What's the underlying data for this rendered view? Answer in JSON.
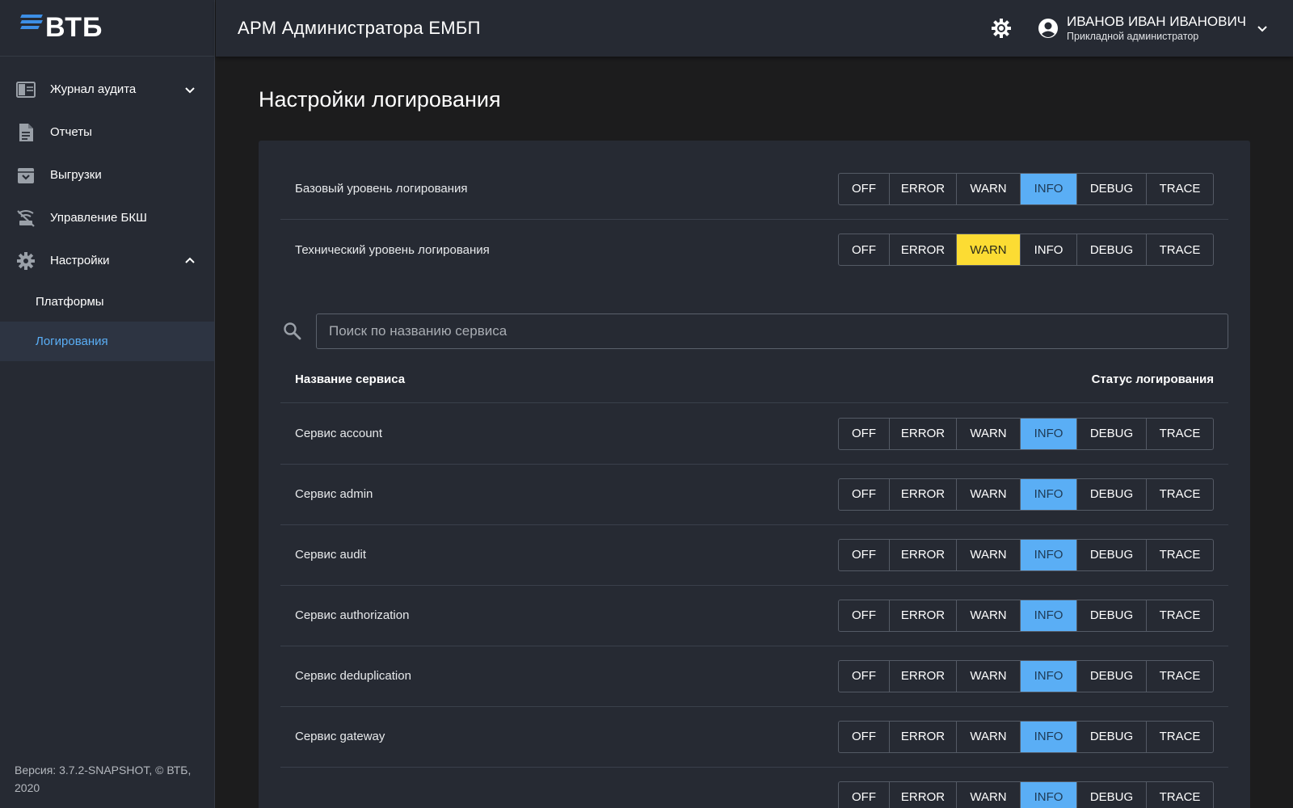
{
  "logo": {
    "text": "ВТБ"
  },
  "header": {
    "title": "АРМ Администратора ЕМБП",
    "user_name": "ИВАНОВ ИВАН ИВАНОВИЧ",
    "user_role": "Прикладной администратор"
  },
  "sidebar": {
    "items": [
      {
        "label": "Журнал аудита",
        "icon": "journal-icon"
      },
      {
        "label": "Отчеты",
        "icon": "document-icon"
      },
      {
        "label": "Выгрузки",
        "icon": "archive-icon"
      },
      {
        "label": "Управление БКШ",
        "icon": "signal-off-icon"
      },
      {
        "label": "Настройки",
        "icon": "gear-icon"
      }
    ],
    "sub_items": [
      {
        "label": "Платформы"
      },
      {
        "label": "Логирования"
      }
    ],
    "version": "Версия: 3.7.2-SNAPSHOT, © ВТБ, 2020"
  },
  "page": {
    "title": "Настройки логирования"
  },
  "levels": [
    "OFF",
    "ERROR",
    "WARN",
    "INFO",
    "DEBUG",
    "TRACE"
  ],
  "global_settings": [
    {
      "label": "Базовый уровень логирования",
      "selected": "INFO"
    },
    {
      "label": "Технический уровень логирования",
      "selected": "WARN"
    }
  ],
  "search": {
    "placeholder": "Поиск по названию сервиса",
    "value": ""
  },
  "table": {
    "col_name": "Название сервиса",
    "col_status": "Статус логирования"
  },
  "services": [
    {
      "label": "Сервис account",
      "selected": "INFO"
    },
    {
      "label": "Сервис admin",
      "selected": "INFO"
    },
    {
      "label": "Сервис audit",
      "selected": "INFO"
    },
    {
      "label": "Сервис authorization",
      "selected": "INFO"
    },
    {
      "label": "Сервис deduplication",
      "selected": "INFO"
    },
    {
      "label": "Сервис gateway",
      "selected": "INFO"
    },
    {
      "label": "",
      "selected": "INFO"
    }
  ],
  "colors": {
    "accent_info": "#5aaef5",
    "accent_warn": "#fcdc33",
    "brand_blue": "#3d8fe6"
  }
}
